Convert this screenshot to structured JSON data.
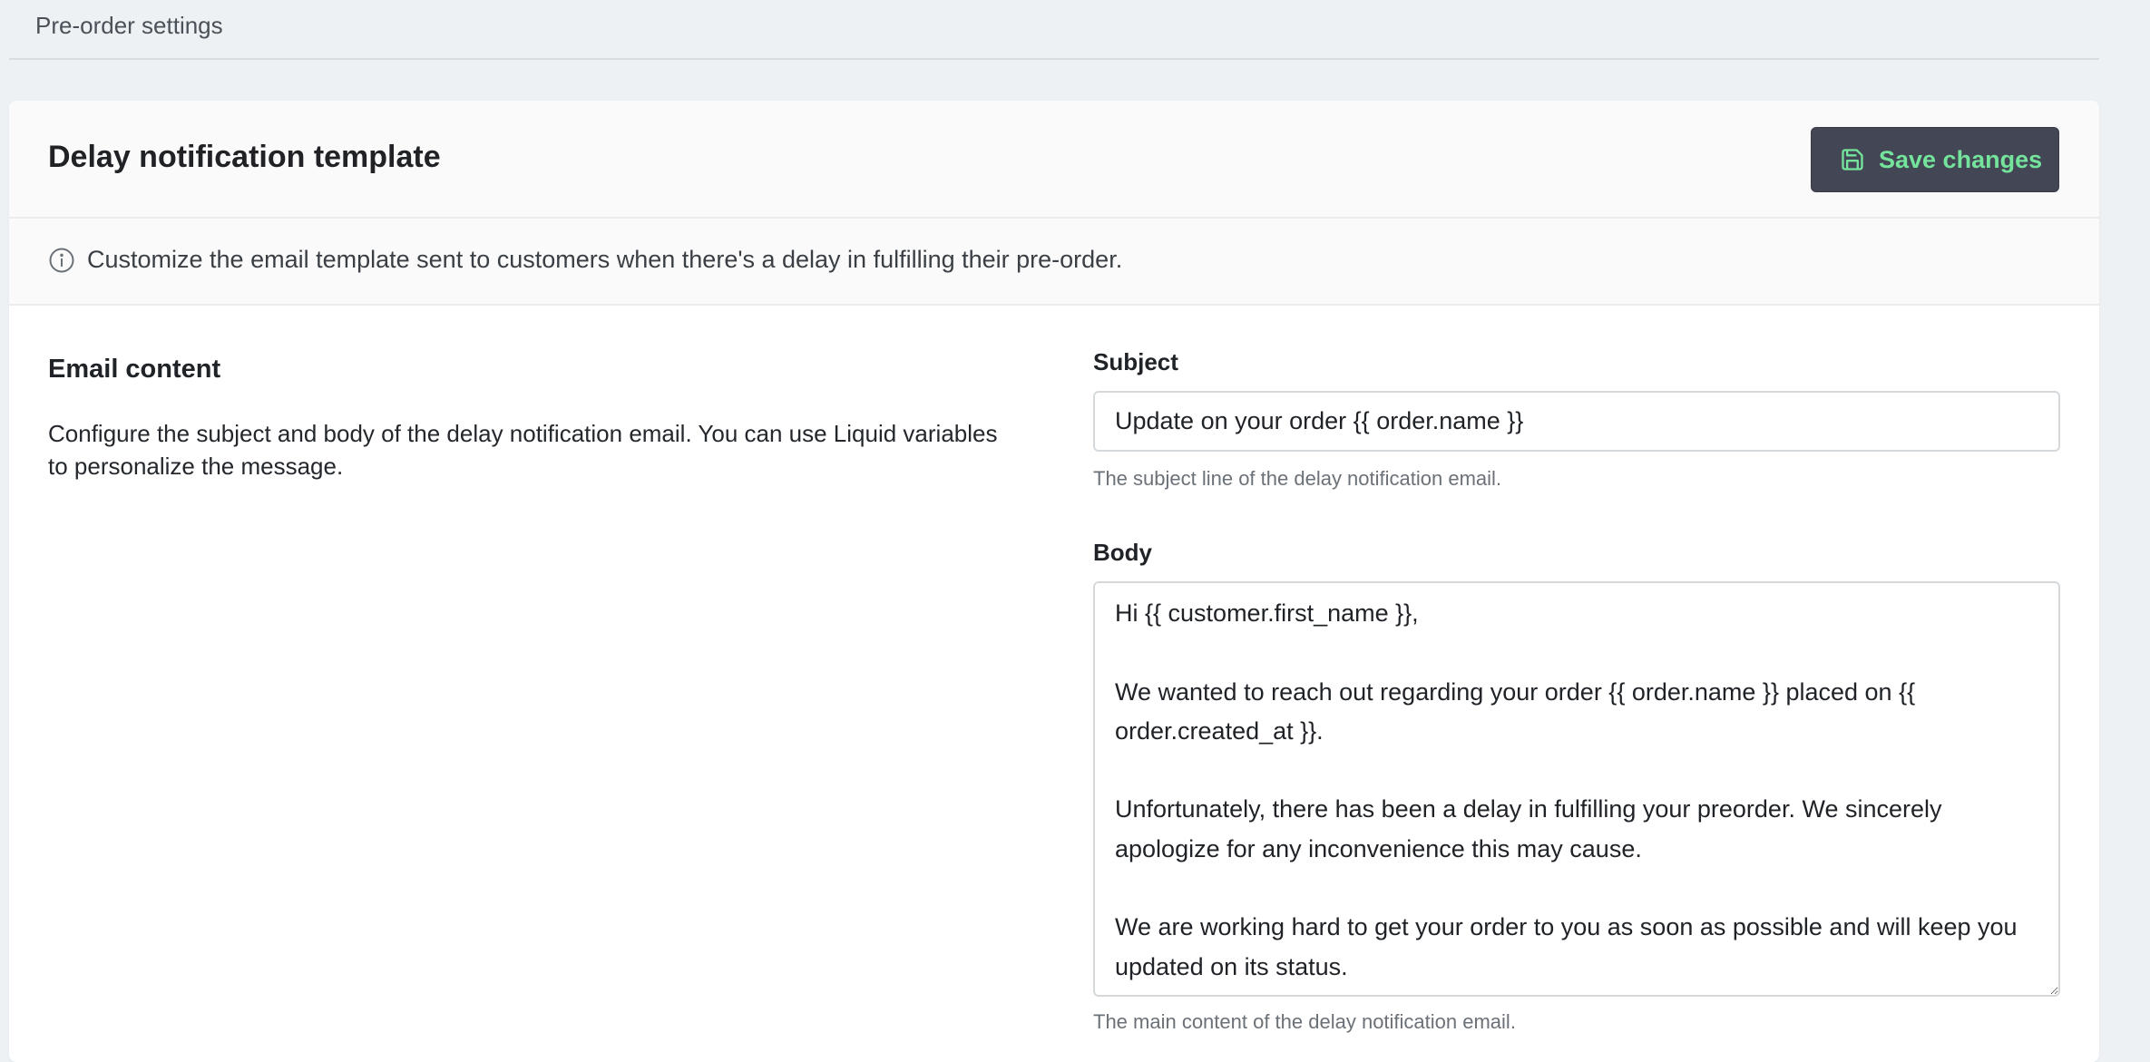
{
  "topbar": {
    "title": "Pre-order settings"
  },
  "card": {
    "title": "Delay notification template",
    "save_label": "Save changes",
    "info_text": "Customize the email template sent to customers when there's a delay in fulfilling their pre-order."
  },
  "section": {
    "title": "Email content",
    "description": "Configure the subject and body of the delay notification email. You can use Liquid variables to personalize the message."
  },
  "subject": {
    "label": "Subject",
    "value": "Update on your order {{ order.name }}",
    "help": "The subject line of the delay notification email."
  },
  "body": {
    "label": "Body",
    "value": "Hi {{ customer.first_name }},\n\nWe wanted to reach out regarding your order {{ order.name }} placed on {{ order.created_at }}.\n\nUnfortunately, there has been a delay in fulfilling your preorder. We sincerely apologize for any inconvenience this may cause.\n\nWe are working hard to get your order to you as soon as possible and will keep you updated on its status.",
    "help": "The main content of the delay notification email."
  },
  "icons": {
    "save": "save-icon",
    "info": "info-icon"
  },
  "colors": {
    "page_bg": "#edf1f4",
    "button_bg": "#434654",
    "button_text": "#74e39b"
  }
}
